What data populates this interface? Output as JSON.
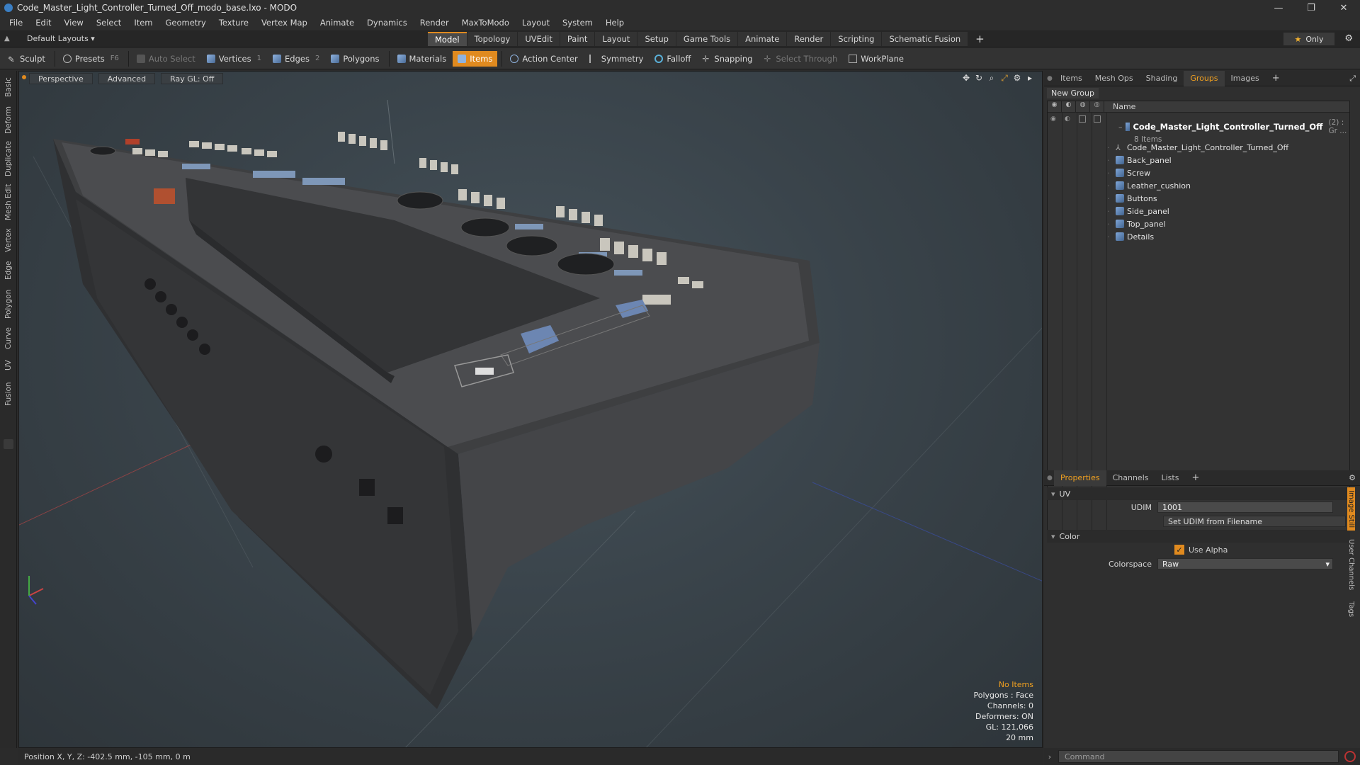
{
  "window": {
    "title": "Code_Master_Light_Controller_Turned_Off_modo_base.lxo - MODO",
    "controls": [
      "—",
      "❐",
      "✕"
    ]
  },
  "menu": [
    "File",
    "Edit",
    "View",
    "Select",
    "Item",
    "Geometry",
    "Texture",
    "Vertex Map",
    "Animate",
    "Dynamics",
    "Render",
    "MaxToModo",
    "Layout",
    "System",
    "Help"
  ],
  "layout_selector": "Default Layouts ▾",
  "layout_tabs": [
    "Model",
    "Topology",
    "UVEdit",
    "Paint",
    "Layout",
    "Setup",
    "Game Tools",
    "Animate",
    "Render",
    "Scripting",
    "Schematic Fusion"
  ],
  "active_layout_tab": "Model",
  "only_button": "Only",
  "toolbar": {
    "sculpt": "Sculpt",
    "presets": "Presets",
    "presets_key": "F6",
    "auto_select": "Auto Select",
    "vertices": "Vertices",
    "vertices_num": "1",
    "edges": "Edges",
    "edges_num": "2",
    "polygons": "Polygons",
    "materials": "Materials",
    "items": "Items",
    "action_center": "Action Center",
    "symmetry": "Symmetry",
    "falloff": "Falloff",
    "snapping": "Snapping",
    "select_through": "Select Through",
    "workplane": "WorkPlane"
  },
  "left_tabs": [
    "Basic",
    "Deform",
    "Duplicate",
    "Mesh Edit",
    "Vertex",
    "Edge",
    "Polygon",
    "Curve",
    "UV",
    "Fusion"
  ],
  "viewport": {
    "view": "Perspective",
    "style": "Advanced",
    "raygl": "Ray GL: Off",
    "hud": {
      "selection": "No Items",
      "polygons": "Polygons : Face",
      "channels": "Channels: 0",
      "deformers": "Deformers: ON",
      "gl": "GL: 121,066",
      "scale": "20 mm"
    }
  },
  "status": "Position X, Y, Z:  -402.5 mm, -105 mm, 0 m",
  "groups_panel": {
    "tabs": [
      "Items",
      "Mesh Ops",
      "Shading",
      "Groups",
      "Images"
    ],
    "active_tab": "Groups",
    "new_group": "New Group",
    "col_name": "Name",
    "group_name": "Code_Master_Light_Controller_Turned_Off",
    "group_suffix": "(2) : Gr ...",
    "group_count": "8 Items",
    "items": [
      "Code_Master_Light_Controller_Turned_Off",
      "Back_panel",
      "Screw",
      "Leather_cushion",
      "Buttons",
      "Side_panel",
      "Top_panel",
      "Details"
    ]
  },
  "properties_panel": {
    "tabs": [
      "Properties",
      "Channels",
      "Lists"
    ],
    "active_tab": "Properties",
    "uv_section": "UV",
    "udim_label": "UDIM",
    "udim_value": "1001",
    "set_udim_button": "Set UDIM from Filename",
    "color_section": "Color",
    "use_alpha": "Use Alpha",
    "colorspace_label": "Colorspace",
    "colorspace_value": "Raw",
    "side_tabs": [
      "Image Still",
      "User Channels",
      "Tags"
    ]
  },
  "command_placeholder": "Command",
  "colors": {
    "accent": "#e08a1f",
    "viewport_bg": "#3a444b"
  }
}
